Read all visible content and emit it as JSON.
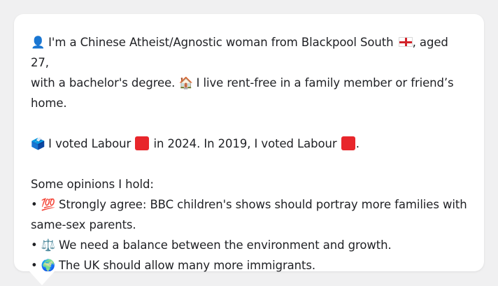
{
  "profile": {
    "line1_a": "I'm a Chinese Atheist/Agnostic woman from Blackpool South",
    "line1_b": ", aged 27,",
    "line2_a": "with a bachelor's degree.",
    "line2_b": "I live rent-free in a family member or friend’s",
    "line3": "home."
  },
  "votes": {
    "text_a": "I voted Labour",
    "text_b": "in 2024. In 2019, I voted Labour",
    "text_c": "."
  },
  "opinions": {
    "heading": "Some opinions I hold:",
    "items": [
      {
        "bullet": "•",
        "icon": "💯",
        "text_line1": "Strongly agree: BBC children's shows should portray more families with",
        "text_line2": "same-sex parents."
      },
      {
        "bullet": "•",
        "icon": "⚖️",
        "text_line1": "We need a balance between the environment and growth."
      },
      {
        "bullet": "•",
        "icon": "🌍",
        "text_line1": "The UK should allow many more immigrants."
      }
    ]
  },
  "icons": {
    "person": "👤",
    "house": "🏠",
    "ballot": "🗳️"
  },
  "colors": {
    "card": "#ffffff",
    "background": "#f0f0f1",
    "text": "#1f2024",
    "labour_red": "#e8262b"
  }
}
